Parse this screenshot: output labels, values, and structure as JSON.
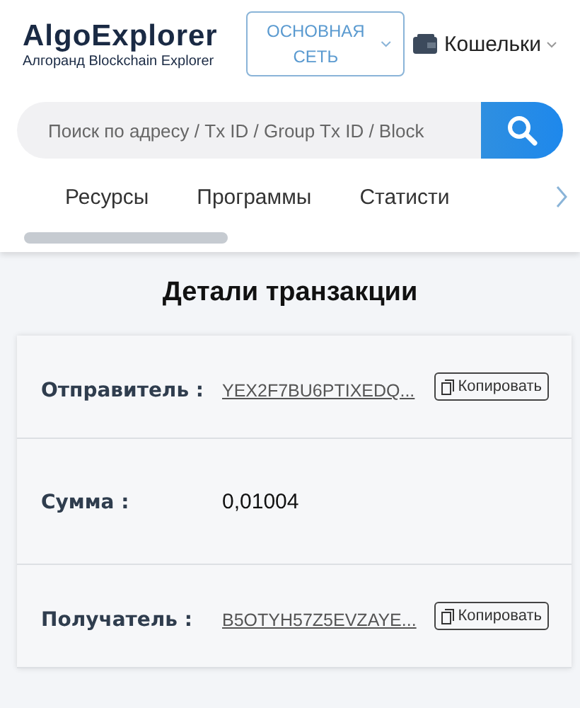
{
  "header": {
    "logo": "AlgoExplorer",
    "tagline": "Алгоранд Blockchain Explorer",
    "network": "ОСНОВНАЯ СЕТЬ",
    "wallets": "Кошельки"
  },
  "search": {
    "placeholder": "Поиск по адресу / Tx ID / Group Tx ID / Block"
  },
  "nav": [
    "Ресурсы",
    "Программы",
    "Статисти"
  ],
  "title": "Детали транзакции",
  "rows": [
    {
      "kind": "address",
      "label": "Отправитель :",
      "value": "YEX2F7BU6PTIXEDQ...",
      "copy": "Копировать"
    },
    {
      "kind": "text",
      "label": "Сумма :",
      "value": "0,01004"
    },
    {
      "kind": "address",
      "label": "Получатель :",
      "value": "B5OTYH57Z5EVZAYE...",
      "copy": "Копировать"
    }
  ]
}
